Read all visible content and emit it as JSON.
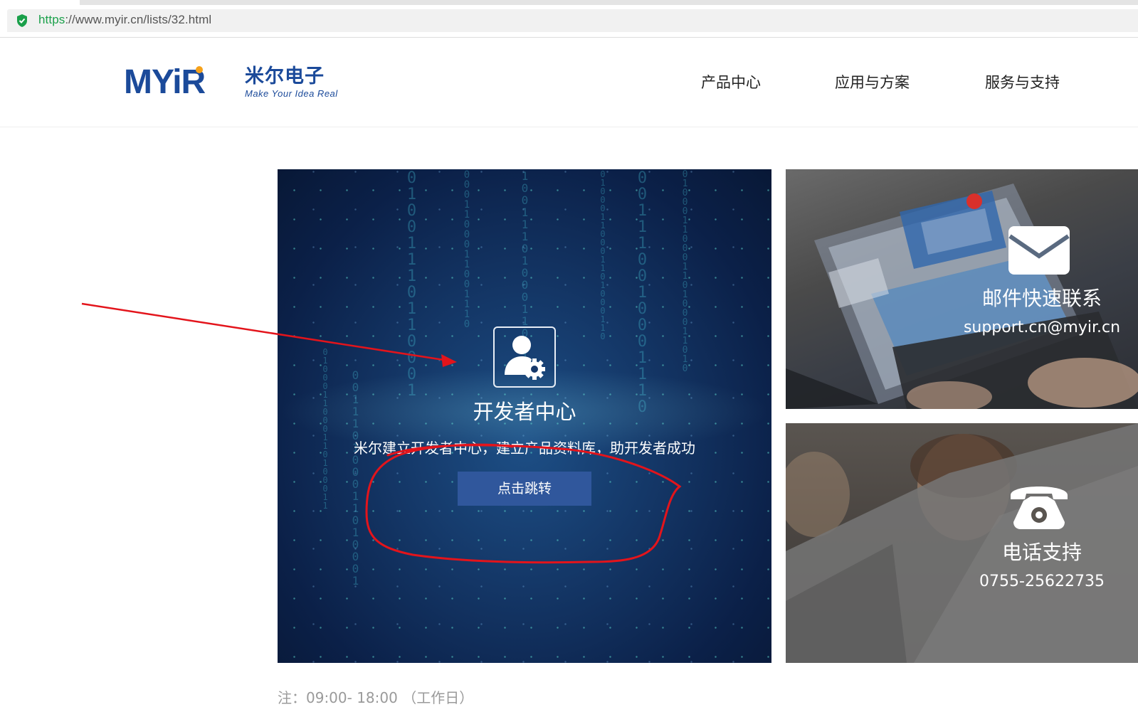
{
  "browser": {
    "url_scheme": "https",
    "url_rest": "://www.myir.cn/lists/32.html"
  },
  "header": {
    "logo_mark": "MYiR",
    "logo_cn": "米尔电子",
    "logo_slogan": "Make Your Idea Real",
    "nav": [
      {
        "label": "产品中心"
      },
      {
        "label": "应用与方案"
      },
      {
        "label": "服务与支持"
      }
    ]
  },
  "developer_card": {
    "title": "开发者中心",
    "description": "米尔建立开发者中心，建立产品资料库，助开发者成功",
    "button_label": "点击跳转",
    "icon": "user-gear-icon"
  },
  "mail_card": {
    "title": "邮件快速联系",
    "email": "support.cn@myir.cn",
    "icon": "envelope-icon"
  },
  "phone_card": {
    "title": "电话支持",
    "number": "0755-25622735",
    "icon": "telephone-icon"
  },
  "note": "注：09:00- 18:00 （工作日）",
  "colors": {
    "brand_blue": "#1b4a9a",
    "button_blue": "#30579c",
    "annotation_red": "#e3141b",
    "secure_green": "#1aa04a"
  }
}
